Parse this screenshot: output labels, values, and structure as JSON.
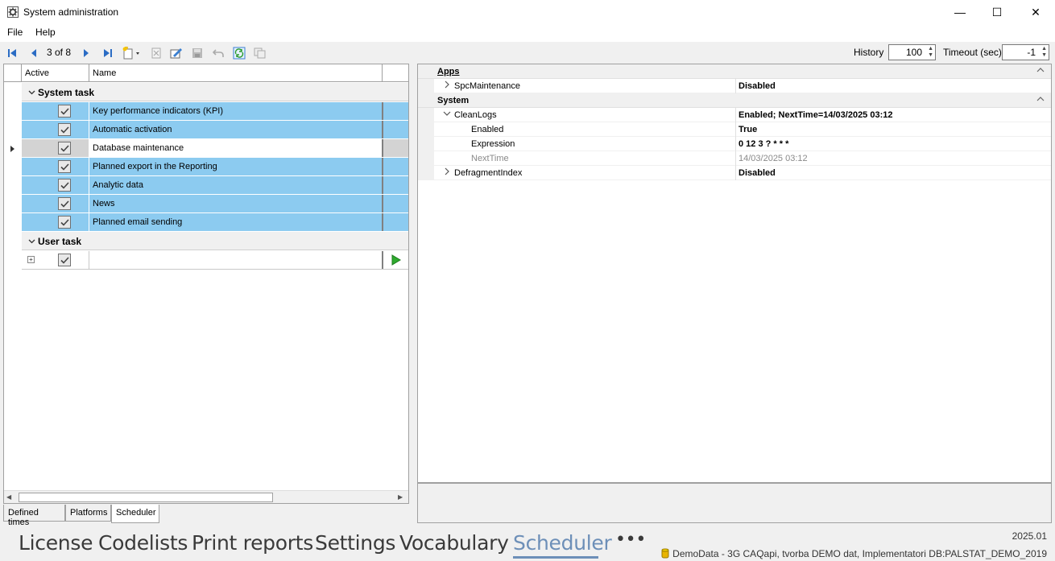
{
  "window": {
    "title": "System administration",
    "controls": {
      "minimize": "—",
      "maximize": "☐",
      "close": "✕"
    }
  },
  "menu": [
    "File",
    "Help"
  ],
  "toolbar": {
    "record_position": "3 of 8",
    "history_label": "History",
    "history_value": "100",
    "timeout_label": "Timeout (sec)",
    "timeout_value": "-1"
  },
  "grid": {
    "columns": [
      "Active",
      "Name"
    ],
    "groups": [
      {
        "label": "System task",
        "rows": [
          {
            "active": true,
            "name": "Key performance indicators (KPI)",
            "state": "selected"
          },
          {
            "active": true,
            "name": "Automatic activation",
            "state": "selected"
          },
          {
            "active": true,
            "name": "Database maintenance",
            "state": "current"
          },
          {
            "active": true,
            "name": "Planned export in the Reporting",
            "state": "selected"
          },
          {
            "active": true,
            "name": "Analytic data",
            "state": "selected"
          },
          {
            "active": true,
            "name": "News",
            "state": "selected"
          },
          {
            "active": true,
            "name": "Planned email sending",
            "state": "selected"
          }
        ]
      },
      {
        "label": "User task",
        "rows": [
          {
            "active": true,
            "name": "",
            "state": "new"
          }
        ]
      }
    ],
    "bottom_tabs": [
      "Defined times",
      "Platforms",
      "Scheduler"
    ],
    "active_tab": "Scheduler"
  },
  "properties": {
    "categories": [
      {
        "label": "Apps",
        "items": [
          {
            "name": "SpcMaintenance",
            "value": "Disabled",
            "level": 1,
            "expander": "collapsed"
          }
        ]
      },
      {
        "label": "System",
        "items": [
          {
            "name": "CleanLogs",
            "value": "Enabled; NextTime=14/03/2025 03:12",
            "level": 1,
            "expander": "expanded"
          },
          {
            "name": "Enabled",
            "value": "True",
            "level": 2
          },
          {
            "name": "Expression",
            "value": "0 12 3 ? * * *",
            "level": 2
          },
          {
            "name": "NextTime",
            "value": "14/03/2025 03:12",
            "level": 2,
            "readonly": true
          },
          {
            "name": "DefragmentIndex",
            "value": "Disabled",
            "level": 1,
            "expander": "collapsed"
          }
        ]
      }
    ]
  },
  "bottom_nav": {
    "items": [
      "License",
      "Codelists",
      "Print reports",
      "Settings",
      "Vocabulary",
      "Scheduler",
      "•••"
    ],
    "active": "Scheduler",
    "version": "2025.01",
    "status": "DemoData - 3G CAQapi, tvorba DEMO dat, Implementatori DB:PALSTAT_DEMO_2019"
  },
  "colors": {
    "selection": "#8ccbf0",
    "nav_active": "#6d8fb8",
    "play_green": "#2eaa2e"
  }
}
